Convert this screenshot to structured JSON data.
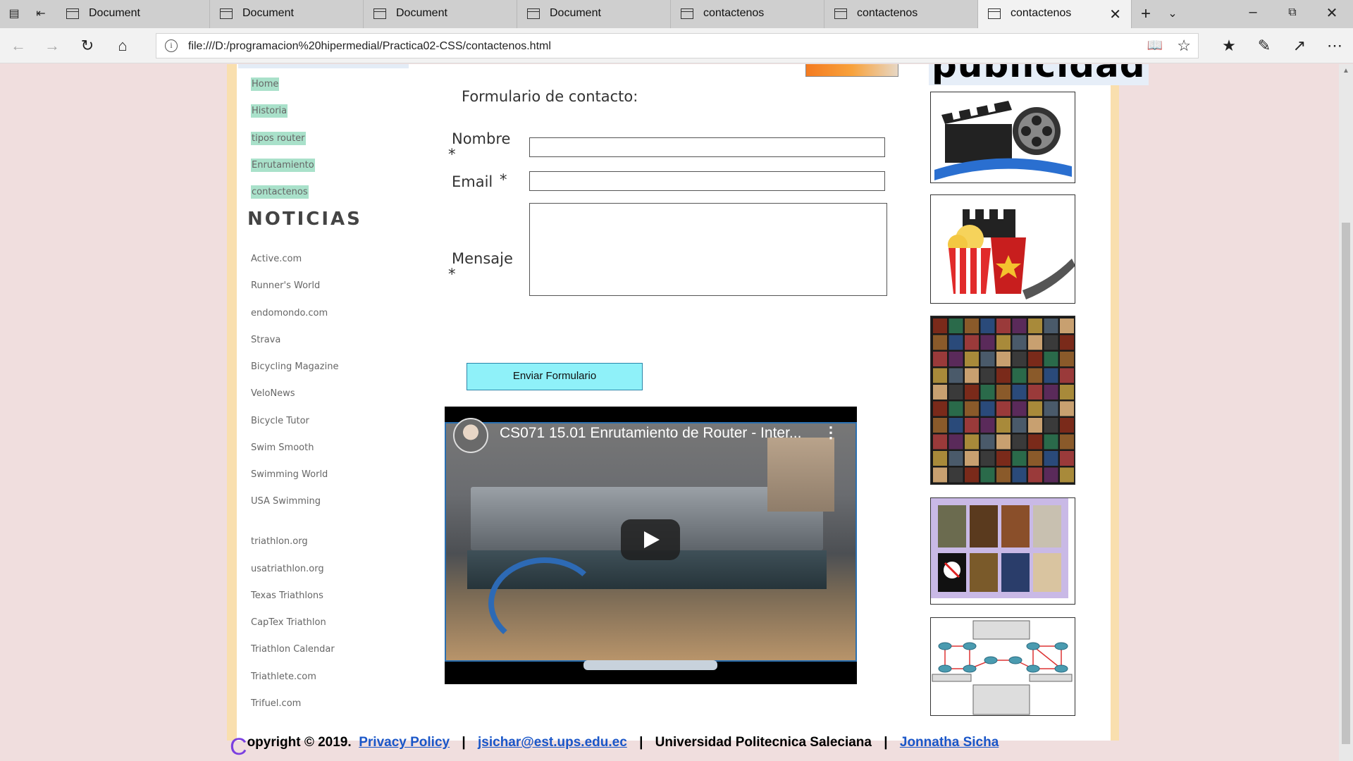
{
  "browser": {
    "tabs": [
      {
        "title": "Document",
        "active": false
      },
      {
        "title": "Document",
        "active": false
      },
      {
        "title": "Document",
        "active": false
      },
      {
        "title": "Document",
        "active": false
      },
      {
        "title": "contactenos",
        "active": false
      },
      {
        "title": "contactenos",
        "active": false
      },
      {
        "title": "contactenos",
        "active": true
      }
    ],
    "address_url": "file:///D:/programacion%20hipermedial/Practica02-CSS/contactenos.html"
  },
  "page": {
    "menu": [
      "Home",
      "Historia",
      "tipos router",
      "Enrutamiento",
      "contactenos"
    ],
    "news_heading": "NOTICIAS",
    "news_links": [
      "Active.com",
      "Runner's World",
      "endomondo.com",
      "Strava",
      "Bicycling Magazine",
      "VeloNews",
      "Bicycle Tutor",
      "Swim Smooth",
      "Swimming World",
      "USA Swimming",
      "triathlon.org",
      "usatriathlon.org",
      "Texas Triathlons",
      "CapTex Triathlon",
      "Triathlon Calendar",
      "Triathlete.com",
      "Trifuel.com"
    ],
    "form": {
      "title": "Formulario de contacto:",
      "nombre_label": "Nombre",
      "email_label": "Email",
      "mensaje_label": "Mensaje",
      "required_mark": "*",
      "nombre_value": "",
      "email_value": "",
      "mensaje_value": "",
      "submit_label": "Enviar Formulario"
    },
    "video": {
      "title": "CS071 15.01 Enrutamiento de Router - Inter..."
    },
    "ads_heading": "publicidad",
    "footer": {
      "copyright_first": "C",
      "copyright_rest": "opyright © 2019.",
      "privacy": "Privacy Policy",
      "email": "jsichar@est.ups.edu.ec",
      "university": "Universidad Politecnica Saleciana",
      "author": "Jonnatha Sicha",
      "separator": "|"
    }
  }
}
